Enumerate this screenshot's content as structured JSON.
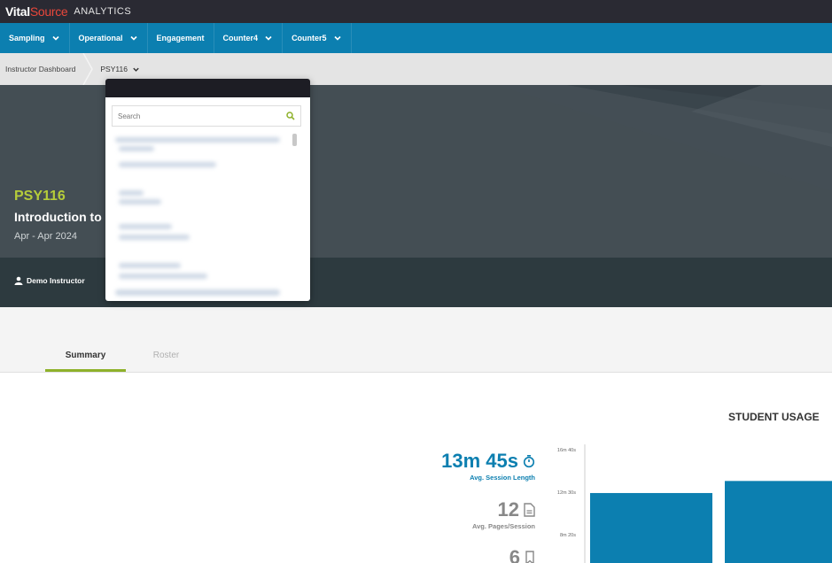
{
  "brand": {
    "name_part1": "Vital",
    "name_part2": "Source",
    "product": "ANALYTICS"
  },
  "nav": [
    {
      "label": "Sampling",
      "has_menu": true
    },
    {
      "label": "Operational",
      "has_menu": true
    },
    {
      "label": "Engagement",
      "has_menu": false
    },
    {
      "label": "Counter4",
      "has_menu": true
    },
    {
      "label": "Counter5",
      "has_menu": true
    }
  ],
  "breadcrumb": {
    "root": "Instructor Dashboard",
    "current": "PSY116"
  },
  "course": {
    "code": "PSY116",
    "title": "Introduction to",
    "dates": "Apr - Apr 2024",
    "instructor": "Demo Instructor"
  },
  "dropdown": {
    "search_placeholder": "Search"
  },
  "tabs": [
    {
      "label": "Summary",
      "active": true
    },
    {
      "label": "Roster",
      "active": false
    }
  ],
  "usage": {
    "title": "STUDENT USAGE",
    "stats": [
      {
        "value": "13m 45s",
        "label": "Avg. Session Length",
        "icon": "timer-icon",
        "color": "#0c7fb0"
      },
      {
        "value": "12",
        "label": "Avg. Pages/Session",
        "icon": "document-icon",
        "color": "#888888"
      },
      {
        "value": "6",
        "label": "",
        "icon": "bookmark-icon",
        "color": "#888888"
      }
    ]
  },
  "chart_data": {
    "type": "bar",
    "categories": [
      "",
      ""
    ],
    "values": [
      745,
      816
    ],
    "yticks": [
      "16m 40s",
      "12m 30s",
      "8m 20s"
    ],
    "ytick_values": [
      1000,
      750,
      500
    ],
    "bar_color": "#0c7fb0"
  },
  "colors": {
    "nav": "#0c7fb0",
    "accent_green": "#b5cc3a",
    "tab_underline": "#8eb12a"
  }
}
